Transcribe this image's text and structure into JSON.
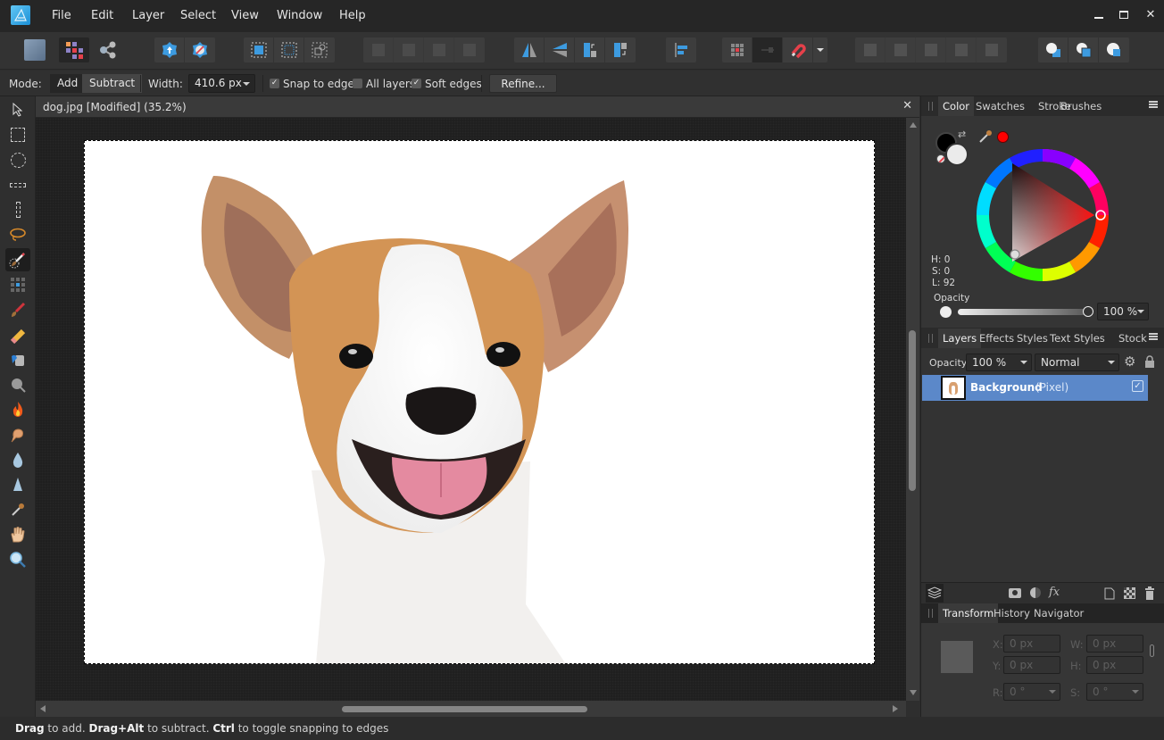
{
  "app": {
    "menu": [
      "File",
      "Edit",
      "Layer",
      "Select",
      "View",
      "Window",
      "Help"
    ],
    "window_controls": {
      "minimize": "minimize-icon",
      "maximize": "maximize-icon",
      "close": "close-icon"
    }
  },
  "toolbar": {
    "personas": [
      "photo-persona-icon",
      "pixel-persona-icon",
      "export-persona-icon"
    ],
    "groups": [
      [
        "quick-mask-icon",
        "mask-off-icon"
      ],
      [
        "select-all-icon",
        "deselect-icon",
        "select-object-icon"
      ],
      [
        "arrange-back-icon",
        "arrange-backward-icon",
        "arrange-forward-icon",
        "arrange-front-icon"
      ],
      [
        "flip-horizontal-icon",
        "flip-vertical-icon",
        "rotate-left-icon",
        "rotate-right-icon"
      ],
      [
        "align-icon"
      ],
      [
        "snap-grid-icon",
        "snap-dark-icon",
        "snapping-magnet-icon",
        "snapping-dropdown-icon"
      ],
      [
        "add-icon",
        "subtract-icon",
        "intersect-icon",
        "xor-icon",
        "divide-icon"
      ],
      [
        "insert-behind-icon",
        "insert-inside-icon",
        "insert-top-icon"
      ]
    ]
  },
  "context": {
    "mode_label": "Mode:",
    "mode_options": [
      "Add",
      "Subtract"
    ],
    "mode_selected": "Add",
    "width_label": "Width:",
    "width_value": "410.6 px",
    "snap_to_edges": {
      "label": "Snap to edges",
      "checked": true
    },
    "all_layers": {
      "label": "All layers",
      "checked": false
    },
    "soft_edges": {
      "label": "Soft edges",
      "checked": true
    },
    "refine_label": "Refine..."
  },
  "tools": [
    "move-tool",
    "rectangular-marquee-tool",
    "elliptical-marquee-tool",
    "row-marquee-tool",
    "column-marquee-tool",
    "freehand-selection-tool",
    "selection-brush-tool",
    "flood-select-tool",
    "paint-brush-tool",
    "erase-brush-tool",
    "flood-fill-tool",
    "dodge-tool",
    "burn-tool",
    "smudge-tool",
    "blur-tool",
    "sharpen-tool",
    "color-picker-tool",
    "view-tool",
    "zoom-tool"
  ],
  "active_tool": "selection-brush-tool",
  "document": {
    "title": "dog.jpg [Modified] (35.2%)"
  },
  "color_panel": {
    "tabs": [
      "Color",
      "Swatches",
      "Stroke",
      "Brushes"
    ],
    "active_tab": "Color",
    "hsl": {
      "h": "H: 0",
      "s": "S: 0",
      "l": "L: 92"
    },
    "opacity_label": "Opacity",
    "opacity_value": "100 %",
    "primary_color": "#000000",
    "secondary_color": "#ebebeb",
    "picked_color": "#ff0000"
  },
  "layers_panel": {
    "tabs": [
      "Layers",
      "Effects",
      "Styles",
      "Text Styles",
      "Stock"
    ],
    "active_tab": "Layers",
    "opacity_label": "Opacity:",
    "opacity_value": "100 %",
    "blend_mode": "Normal",
    "layers": [
      {
        "name": "Background",
        "type": "(Pixel)",
        "visible": true,
        "selected": true
      }
    ],
    "footer_icons": [
      "layers-icon",
      "mask-icon",
      "adjustment-icon",
      "fx-icon",
      "new-layer-icon",
      "checker-icon",
      "trash-icon"
    ]
  },
  "transform_panel": {
    "tabs": [
      "Transform",
      "History",
      "Navigator"
    ],
    "active_tab": "Transform",
    "x_label": "X:",
    "x_value": "0 px",
    "y_label": "Y:",
    "y_value": "0 px",
    "w_label": "W:",
    "w_value": "0 px",
    "h_label": "H:",
    "h_value": "0 px",
    "r_label": "R:",
    "r_value": "0 °",
    "s_label": "S:",
    "s_value": "0 °"
  },
  "status": {
    "parts": [
      {
        "bold": "Drag",
        "text": " to add. "
      },
      {
        "bold": "Drag+Alt",
        "text": " to subtract. "
      },
      {
        "bold": "Ctrl",
        "text": " to toggle snapping to edges"
      }
    ]
  },
  "colors": {
    "accent": "#5b88c9",
    "toolbar_blue": "#3d9be0",
    "background": "#2e2e2e"
  }
}
